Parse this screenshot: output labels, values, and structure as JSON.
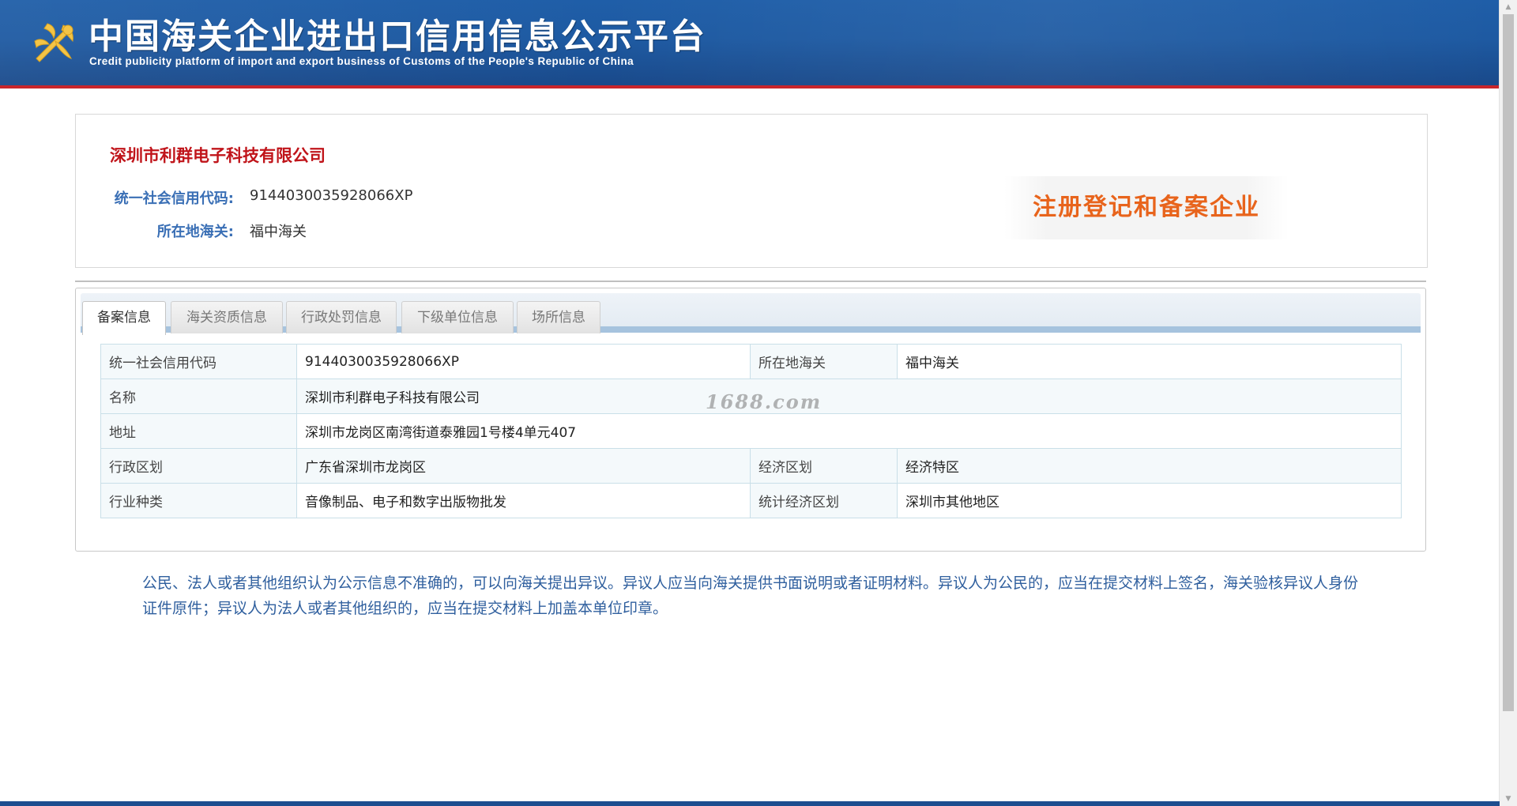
{
  "header": {
    "title": "中国海关企业进出口信用信息公示平台",
    "subtitle": "Credit publicity platform of import and export business of Customs of the People's Republic of China",
    "logo_icon": "customs-emblem-icon"
  },
  "company": {
    "name": "深圳市利群电子科技有限公司",
    "credit_code_label": "统一社会信用代码:",
    "credit_code": "914403003592 8066XP",
    "customs_label": "所在地海关:",
    "customs": "福中海关",
    "status_stamp": "注册登记和备案企业"
  },
  "tabs": [
    {
      "label": "备案信息",
      "active": true
    },
    {
      "label": "海关资质信息",
      "active": false
    },
    {
      "label": "行政处罚信息",
      "active": false
    },
    {
      "label": "下级单位信息",
      "active": false
    },
    {
      "label": "场所信息",
      "active": false
    }
  ],
  "table": {
    "rows": [
      {
        "k1": "统一社会信用代码",
        "v1": "9144030035928066XP",
        "k2": "所在地海关",
        "v2": "福中海关"
      },
      {
        "k1": "名称",
        "v1": "深圳市利群电子科技有限公司"
      },
      {
        "k1": "地址",
        "v1": "深圳市龙岗区南湾街道泰雅园1号楼4单元407"
      },
      {
        "k1": "行政区划",
        "v1": "广东省深圳市龙岗区",
        "k2": "经济区划",
        "v2": "经济特区"
      },
      {
        "k1": "行业种类",
        "v1": "音像制品、电子和数字出版物批发",
        "k2": "统计经济区划",
        "v2": "深圳市其他地区"
      }
    ]
  },
  "watermark": "1688.com",
  "notice": "公民、法人或者其他组织认为公示信息不准确的，可以向海关提出异议。异议人应当向海关提供书面说明或者证明材料。异议人为公民的，应当在提交材料上签名，海关验核异议人身份证件原件；异议人为法人或者其他组织的，应当在提交材料上加盖本单位印章。",
  "colors": {
    "header_blue": "#1e5aa2",
    "header_red_line": "#c8252b",
    "company_name_red": "#c0141a",
    "label_blue": "#3a6fb5",
    "stamp_orange": "#e8641c",
    "notice_blue": "#2f5f9e"
  }
}
